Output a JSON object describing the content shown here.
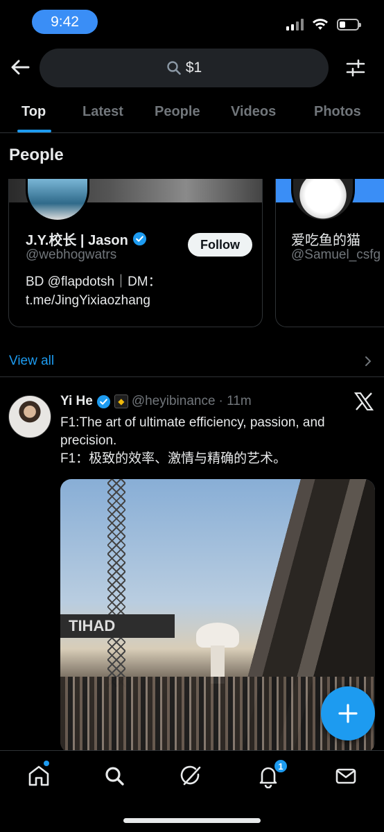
{
  "status_bar": {
    "time": "9:42"
  },
  "search": {
    "query": "$1"
  },
  "tabs": [
    {
      "label": "Top"
    },
    {
      "label": "Latest"
    },
    {
      "label": "People"
    },
    {
      "label": "Videos"
    },
    {
      "label": "Photos"
    }
  ],
  "people": {
    "section_title": "People",
    "cards": [
      {
        "name": "J.Y.校长 | Jason",
        "handle": "@webhogwatrs",
        "bio": "BD @flapdotsh｜DM：t.me/JingYixiaozhang",
        "follow_label": "Follow"
      },
      {
        "name": "爱吃鱼的猫",
        "handle": "@Samuel_csfg"
      }
    ],
    "view_all_label": "View all"
  },
  "tweet": {
    "author_name": "Yi He",
    "author_handle": "@heyibinance",
    "time": "· 11m",
    "text_line1": "F1:The art of ultimate efficiency, passion, and precision.",
    "text_line2": "F1：极致的效率、激情与精确的艺术。",
    "media_sign_text": "TIHAD"
  },
  "bottom_nav": {
    "notifications_count": "1"
  },
  "colors": {
    "accent": "#1d9bf0",
    "background": "#000000",
    "secondary_text": "#71767b",
    "time_pill": "#3a8ef6"
  },
  "icons": [
    "back-arrow-icon",
    "search-icon",
    "filter-icon",
    "verified-icon",
    "chevron-right-icon",
    "x-logo-icon",
    "compose-plus-icon",
    "home-icon",
    "explore-search-icon",
    "grok-icon",
    "bell-icon",
    "mail-icon"
  ]
}
